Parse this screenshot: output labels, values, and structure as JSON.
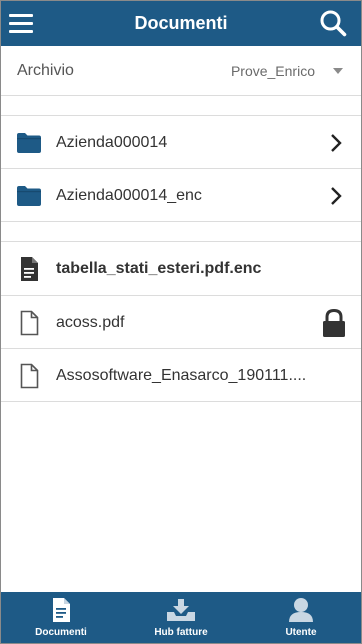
{
  "header": {
    "title": "Documenti",
    "menu_icon": "hamburger-menu-icon",
    "search_icon": "search-icon"
  },
  "archive": {
    "label": "Archivio",
    "selected": "Prove_Enrico"
  },
  "folders": [
    {
      "name": "Azienda000014",
      "icon": "folder-icon"
    },
    {
      "name": "Azienda000014_enc",
      "icon": "folder-icon"
    }
  ],
  "files": [
    {
      "name": "tabella_stati_esteri.pdf.enc",
      "icon": "file-filled-icon",
      "locked": false
    },
    {
      "name": "acoss.pdf",
      "icon": "file-outline-icon",
      "locked": true
    },
    {
      "name": "Assosoftware_Enasarco_190111....",
      "icon": "file-outline-icon",
      "locked": false
    }
  ],
  "tabs": [
    {
      "label": "Documenti",
      "icon": "document-icon",
      "active": true
    },
    {
      "label": "Hub fatture",
      "icon": "inbox-download-icon",
      "active": false
    },
    {
      "label": "Utente",
      "icon": "user-icon",
      "active": false
    }
  ],
  "colors": {
    "primary": "#1e5a86",
    "folder": "#1e5a86",
    "text": "#333333",
    "separator": "#dcdcdc"
  }
}
